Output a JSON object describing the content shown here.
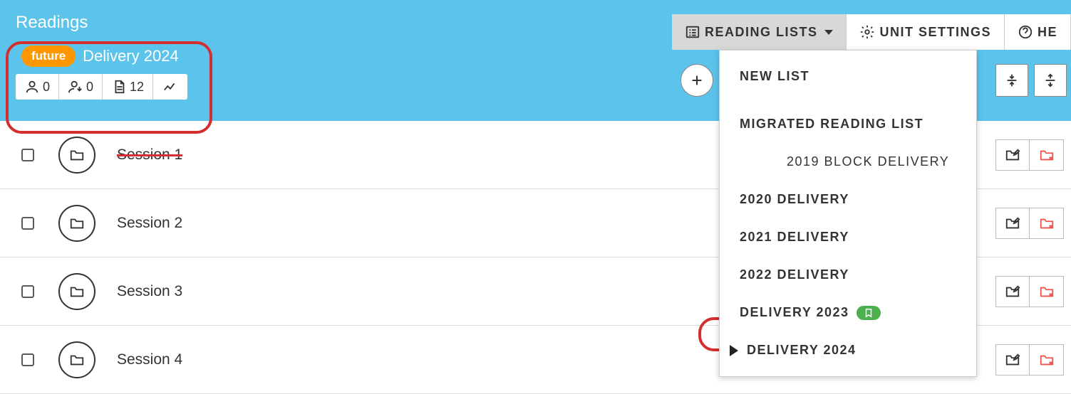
{
  "header": {
    "title": "Readings",
    "badge_text": "future",
    "delivery_title": "Delivery 2024",
    "stats": {
      "educators": "0",
      "students": "0",
      "readings": "12"
    }
  },
  "topbar": {
    "reading_lists": "READING LISTS",
    "unit_settings": "UNIT SETTINGS",
    "help": "HE"
  },
  "dropdown": {
    "new_list": "NEW LIST",
    "items": [
      {
        "label": "MIGRATED READING LIST",
        "sub": false
      },
      {
        "label": "2019 BLOCK DELIVERY",
        "sub": true
      },
      {
        "label": "2020 DELIVERY",
        "sub": false
      },
      {
        "label": "2021 DELIVERY",
        "sub": false
      },
      {
        "label": "2022 DELIVERY",
        "sub": false
      },
      {
        "label": "DELIVERY 2023",
        "sub": false,
        "bookmark": true
      },
      {
        "label": "DELIVERY 2024",
        "sub": false,
        "current": true
      }
    ]
  },
  "sessions": [
    {
      "name": "Session 1",
      "struck": true
    },
    {
      "name": "Session 2"
    },
    {
      "name": "Session 3"
    },
    {
      "name": "Session 4"
    }
  ]
}
